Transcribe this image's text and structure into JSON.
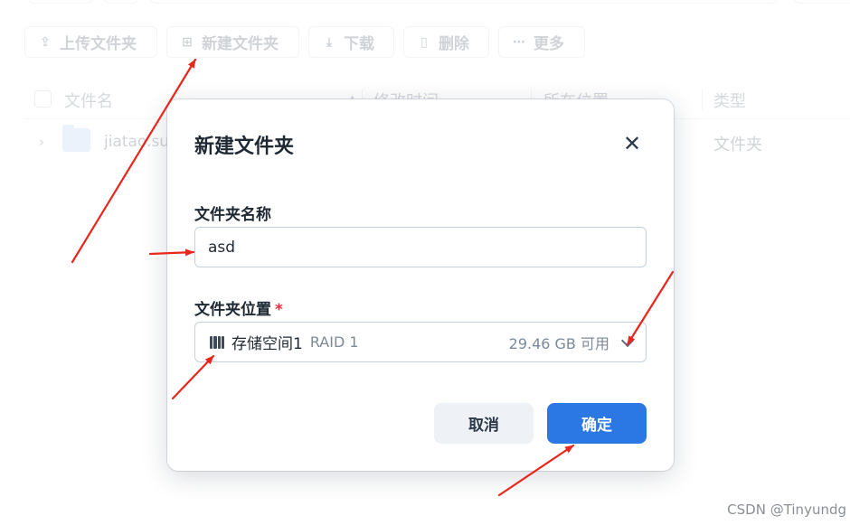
{
  "toolbar": {
    "buttons": [
      {
        "label": "上传文件夹",
        "icon": "upload-icon",
        "glyph": "⇪"
      },
      {
        "label": "新建文件夹",
        "icon": "new-folder-icon",
        "glyph": "⊞"
      },
      {
        "label": "下载",
        "icon": "download-icon",
        "glyph": "⤓"
      },
      {
        "label": "删除",
        "icon": "trash-icon",
        "glyph": "▯"
      },
      {
        "label": "更多",
        "icon": "more-icon",
        "glyph": "⋯"
      }
    ]
  },
  "table": {
    "columns": [
      "文件名",
      "修改时间",
      "所在位置",
      "类型"
    ],
    "rows": [
      {
        "name": "jiatao.sun",
        "type": "文件夹"
      }
    ]
  },
  "dialog": {
    "title": "新建文件夹",
    "close_icon": "close-icon",
    "name_label": "文件夹名称",
    "name_value": "asd",
    "location_label": "文件夹位置",
    "required_mark": "*",
    "location": {
      "name": "存储空间1",
      "raid": "RAID 1",
      "free": "29.46 GB 可用"
    },
    "cancel_label": "取消",
    "confirm_label": "确定"
  },
  "colors": {
    "primary": "#2b78e4",
    "required": "#e5303b",
    "annotation_arrow": "#e8261c"
  },
  "watermark": "CSDN @Tinyundg"
}
